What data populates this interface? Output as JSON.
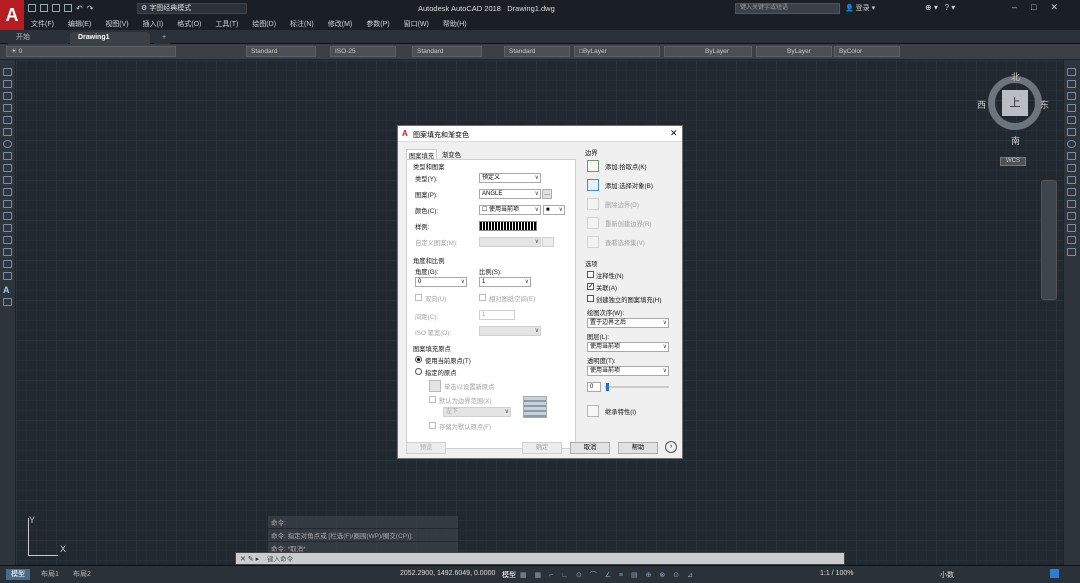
{
  "app": {
    "title": "Autodesk AutoCAD 2018",
    "file": "Drawing1.dwg",
    "search_placeholder": "键入关键字或短语",
    "login": "登录",
    "workspace": "字图经典模式",
    "logo": "A"
  },
  "menu": [
    "文件(F)",
    "编辑(E)",
    "视图(V)",
    "插入(I)",
    "格式(O)",
    "工具(T)",
    "绘图(D)",
    "标注(N)",
    "修改(M)",
    "参数(P)",
    "窗口(W)",
    "帮助(H)"
  ],
  "tabs": {
    "start": "开始",
    "drawing": "Drawing1",
    "plus": "+"
  },
  "props": {
    "layer": "0",
    "text_style": "Standard",
    "dim_style": "ISO-25",
    "table_style": "Standard",
    "mleader_style": "Standard",
    "color": "ByLayer",
    "linetype": "ByLayer",
    "lineweight": "ByLayer",
    "plotstyle": "ByColor"
  },
  "viewcube": {
    "north": "北",
    "south": "南",
    "east": "东",
    "west": "西",
    "top": "上",
    "wcs": "WCS"
  },
  "ucs": {
    "x": "X",
    "y": "Y"
  },
  "command": {
    "line1": "命令:",
    "line2": "命令: 指定对角点或 [栏选(F)/圈围(WP)/圈交(CP)]:",
    "line3": "命令: *取消*",
    "prompt": "键入命令"
  },
  "layout_tabs": [
    "模型",
    "布局1",
    "布局2"
  ],
  "status": {
    "coords": "2052.2900, 1492.6049, 0.0000",
    "model": "模型",
    "scale": "1:1 / 100%",
    "units": "小数"
  },
  "dialog": {
    "title": "图案填充和渐变色",
    "tab_hatch": "图案填充",
    "tab_gradient": "渐变色",
    "type_pattern": "类型和图案",
    "type_label": "类型(Y):",
    "type_value": "预定义",
    "pattern_label": "图案(P):",
    "pattern_value": "ANGLE",
    "color_label": "颜色(C):",
    "color_value": "使用当前项",
    "swatch_label": "样例:",
    "custom_label": "自定义图案(M):",
    "angle_scale": "角度和比例",
    "angle_label": "角度(G):",
    "angle_value": "0",
    "scale_label": "比例(S):",
    "scale_value": "1",
    "double_label": "双向(U)",
    "relative_label": "相对图纸空间(E)",
    "spacing_label": "间距(C):",
    "spacing_value": "1",
    "iso_label": "ISO 笔宽(O):",
    "origin": "图案填充原点",
    "use_current": "使用当前原点(T)",
    "specified": "指定的原点",
    "click_set": "单击以设置新原点",
    "default_bounds": "默认为边界范围(X)",
    "bottom_left": "左下",
    "store_default": "存储为默认原点(F)",
    "boundaries": "边界",
    "add_pick": "添加:拾取点(K)",
    "add_select": "添加:选择对象(B)",
    "remove": "删除边界(D)",
    "recreate": "重新创建边界(R)",
    "view_sel": "查看选择集(V)",
    "options": "选项",
    "annotative": "注释性(N)",
    "associative": "关联(A)",
    "separate": "创建独立的图案填充(H)",
    "draw_order_label": "绘图次序(W):",
    "draw_order_value": "置于边界之后",
    "layer_label": "图层(L):",
    "layer_value": "使用当前项",
    "transparency_label": "透明度(T):",
    "transparency_value": "使用当前项",
    "transparency_num": "0",
    "inherit": "继承特性(I)",
    "preview": "预览",
    "ok": "确定",
    "cancel": "取消",
    "help": "帮助"
  }
}
